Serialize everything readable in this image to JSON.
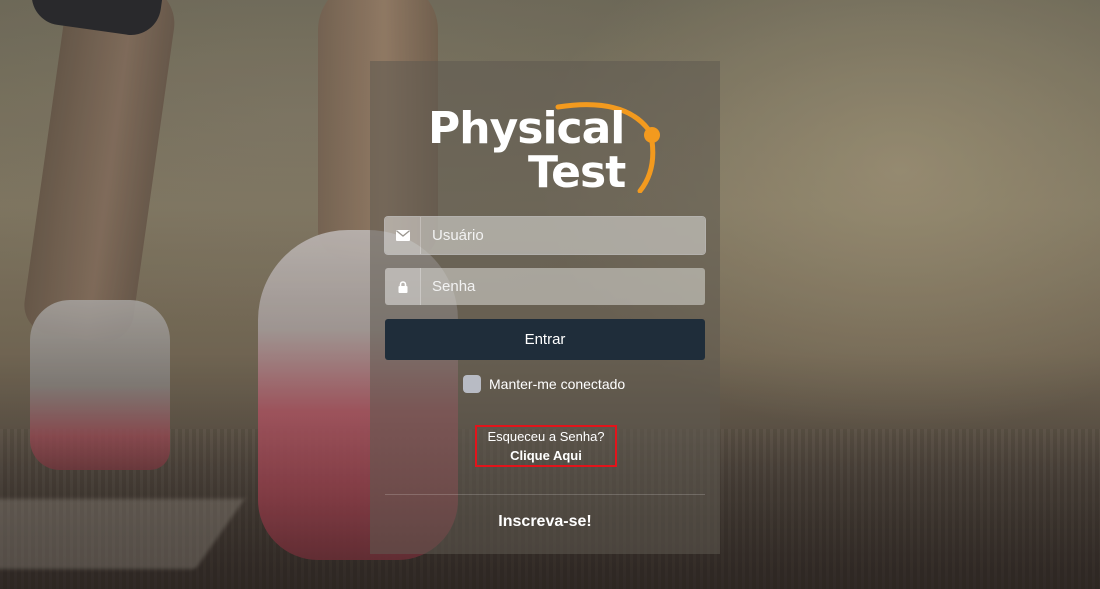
{
  "logo": {
    "line1": "Physical",
    "line2": "Test",
    "accent_color": "#f39a1e"
  },
  "login_form": {
    "username_placeholder": "Usuário",
    "username_icon": "envelope-icon",
    "password_placeholder": "Senha",
    "password_icon": "lock-icon",
    "submit_label": "Entrar",
    "remember_label": "Manter-me conectado",
    "forgot_text": "Esqueceu a Senha?",
    "forgot_link": "Clique Aqui",
    "signup_label": "Inscreva-se!"
  },
  "colors": {
    "button_bg": "#1f2d3a",
    "highlight_border": "#e2141b"
  }
}
